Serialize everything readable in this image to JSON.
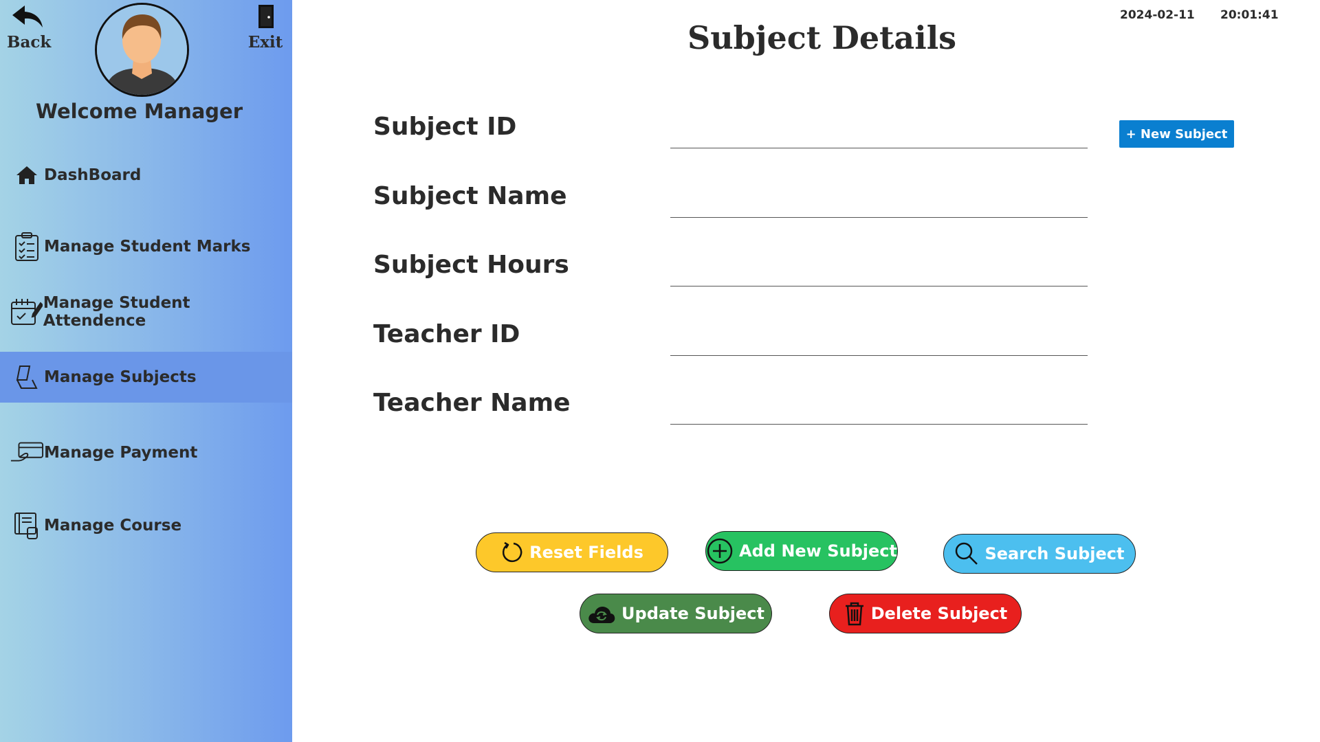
{
  "header": {
    "back_label": "Back",
    "exit_label": "Exit",
    "welcome": "Welcome Manager",
    "title": "Subject Details",
    "date": "2024-02-11",
    "time": "20:01:41"
  },
  "sidebar": {
    "items": [
      {
        "label": "DashBoard",
        "icon": "home-icon"
      },
      {
        "label": "Manage Student Marks",
        "icon": "clipboard-checklist-icon"
      },
      {
        "label": "Manage Student Attendence",
        "icon": "calendar-edit-icon"
      },
      {
        "label": "Manage Subjects",
        "icon": "book-icon",
        "active": true
      },
      {
        "label": "Manage Payment",
        "icon": "hand-card-icon"
      },
      {
        "label": "Manage Course",
        "icon": "course-book-icon"
      }
    ]
  },
  "form": {
    "fields": [
      {
        "label": "Subject ID",
        "value": ""
      },
      {
        "label": "Subject Name",
        "value": ""
      },
      {
        "label": "Subject Hours",
        "value": ""
      },
      {
        "label": "Teacher ID",
        "value": ""
      },
      {
        "label": "Teacher Name",
        "value": ""
      }
    ],
    "new_subject_label": "+ New Subject"
  },
  "actions": {
    "reset": "Reset Fields",
    "add": "Add New Subject",
    "search": "Search Subject",
    "update": "Update Subject",
    "delete": "Delete Subject"
  },
  "colors": {
    "reset": "#fdc82a",
    "add": "#27c261",
    "search": "#4cbfef",
    "update": "#4a8a4a",
    "delete": "#e8201e",
    "active_nav": "#6a96e8",
    "new_subject": "#0a7fd0"
  }
}
